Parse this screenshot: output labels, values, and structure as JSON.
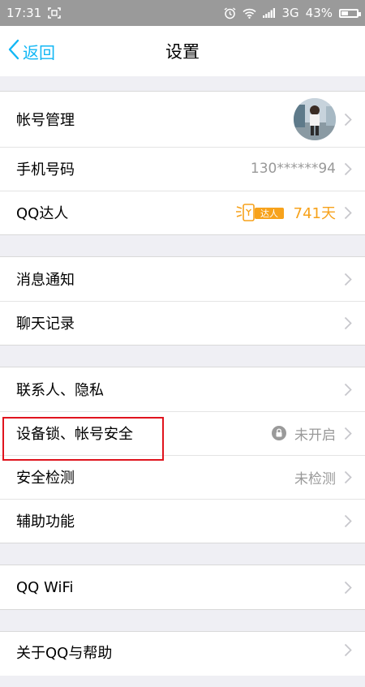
{
  "status_bar": {
    "time": "17:31",
    "network": "3G",
    "battery": "43%",
    "battery_level": 0.43
  },
  "nav": {
    "back_label": "返回",
    "title": "设置"
  },
  "groups": [
    {
      "items": [
        {
          "label": "帐号管理",
          "right": "avatar"
        },
        {
          "label": "手机号码",
          "value": "130******94"
        },
        {
          "label": "QQ达人",
          "badge_text": "达人",
          "value": "741天"
        }
      ]
    },
    {
      "items": [
        {
          "label": "消息通知"
        },
        {
          "label": "聊天记录"
        }
      ]
    },
    {
      "items": [
        {
          "label": "联系人、隐私"
        },
        {
          "label": "设备锁、帐号安全",
          "value": "未开启",
          "icon": "lock-icon"
        },
        {
          "label": "安全检测",
          "value": "未检测"
        },
        {
          "label": "辅助功能"
        }
      ]
    },
    {
      "items": [
        {
          "label": "QQ WiFi"
        }
      ]
    },
    {
      "items": [
        {
          "label": "关于QQ与帮助"
        }
      ]
    }
  ],
  "colors": {
    "accent": "#12b7f5",
    "daren": "#f7a21b",
    "highlight": "#e0141e",
    "background": "#efeff4"
  }
}
